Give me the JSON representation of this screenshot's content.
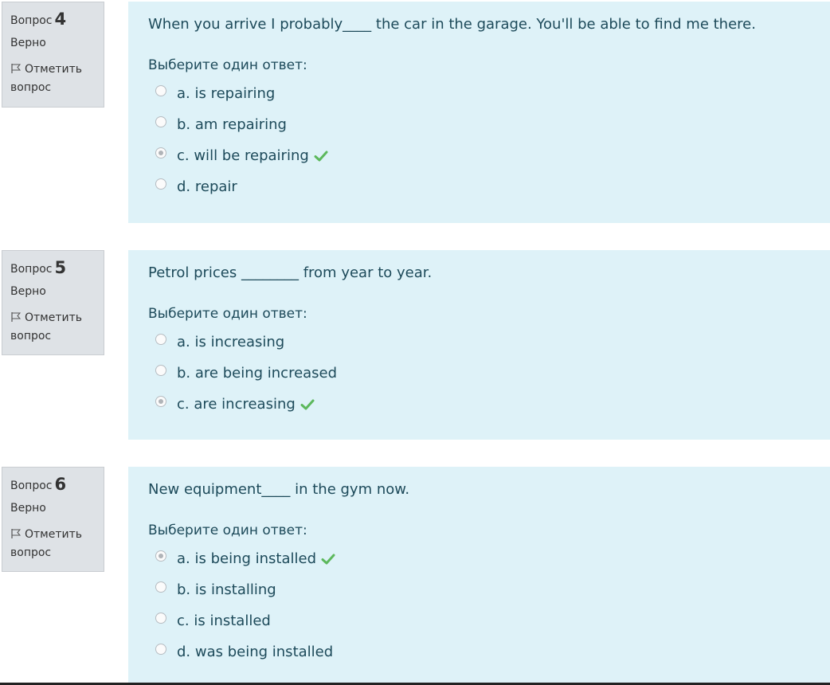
{
  "questions": [
    {
      "label": "Вопрос",
      "number": "4",
      "state": "Верно",
      "flag_label": "Отметить вопрос",
      "text": "When you arrive I probably____  the car in the garage. You'll be able to find me there.",
      "prompt": "Выберите один ответ:",
      "answers": [
        {
          "text": "a. is repairing",
          "selected": false,
          "correct": false
        },
        {
          "text": "b. am repairing",
          "selected": false,
          "correct": false
        },
        {
          "text": "c. will be repairing",
          "selected": true,
          "correct": true
        },
        {
          "text": "d. repair",
          "selected": false,
          "correct": false
        }
      ]
    },
    {
      "label": "Вопрос",
      "number": "5",
      "state": "Верно",
      "flag_label": "Отметить вопрос",
      "text": "Petrol prices ________   from year to year.",
      "prompt": "Выберите один ответ:",
      "answers": [
        {
          "text": "a. is increasing",
          "selected": false,
          "correct": false
        },
        {
          "text": "b. are being increased",
          "selected": false,
          "correct": false
        },
        {
          "text": "c. are increasing",
          "selected": true,
          "correct": true
        }
      ]
    },
    {
      "label": "Вопрос",
      "number": "6",
      "state": "Верно",
      "flag_label": "Отметить вопрос",
      "text": "New equipment____ in the gym now.",
      "prompt": "Выберите один ответ:",
      "answers": [
        {
          "text": "a. is being installed",
          "selected": true,
          "correct": true
        },
        {
          "text": "b. is installing",
          "selected": false,
          "correct": false
        },
        {
          "text": "c. is installed",
          "selected": false,
          "correct": false
        },
        {
          "text": "d. was being installed",
          "selected": false,
          "correct": false
        }
      ]
    }
  ],
  "colors": {
    "content_bg": "#def2f8",
    "info_bg": "#dee2e6",
    "text": "#1d4a5a",
    "correct_check": "#5cb85c"
  },
  "icons": {
    "flag": "flag-icon",
    "correct": "check-icon"
  }
}
